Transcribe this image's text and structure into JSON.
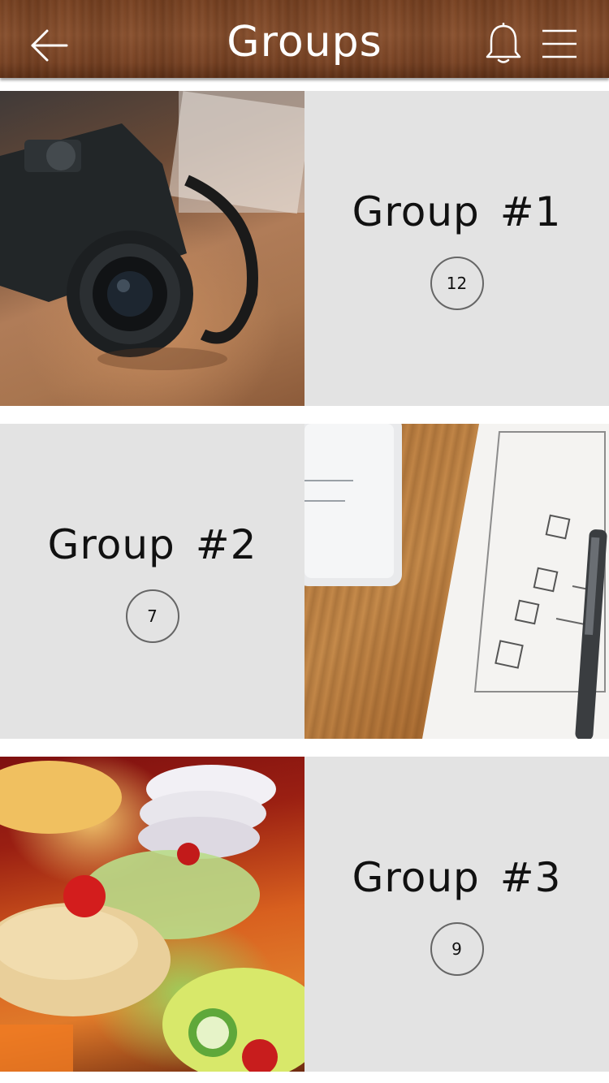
{
  "header": {
    "title": "Groups",
    "back_icon": "arrow-left-icon",
    "notifications_icon": "bell-icon",
    "menu_icon": "hamburger-menu-icon",
    "colors": {
      "wood": "#7a4424",
      "title": "#ffffff"
    }
  },
  "groups": [
    {
      "name": "Group #1",
      "count": "12",
      "photo": "camera-on-wooden-table"
    },
    {
      "name": "Group #2",
      "count": "7",
      "photo": "app-sketch-on-wooden-desk"
    },
    {
      "name": "Group #3",
      "count": "9",
      "photo": "salad-buffet"
    }
  ],
  "colors": {
    "card_background": "#e3e3e3",
    "badge_border": "#666666",
    "text": "#111111"
  }
}
